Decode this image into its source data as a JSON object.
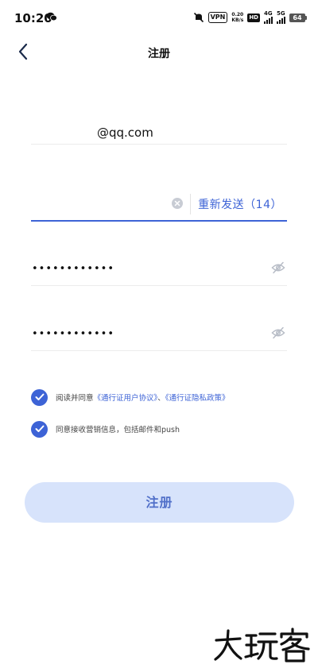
{
  "status_bar": {
    "time": "10:20",
    "vpn": "VPN",
    "speed_value": "0.20",
    "speed_unit": "KB/s",
    "hd": "HD",
    "net1": "4G",
    "net2": "5G",
    "battery": "64"
  },
  "header": {
    "title": "注册"
  },
  "form": {
    "email_value": "@qq.com",
    "resend_label": "重新发送（14）",
    "password_mask": "••••••••••••",
    "confirm_password_mask": "••••••••••••"
  },
  "agreements": {
    "terms_prefix": "阅读并同意",
    "terms_link_user": "《通行证用户协议》",
    "terms_sep": "、",
    "terms_link_privacy": "《通行证隐私政策》",
    "marketing_text": "同意接收营销信息，包括邮件和push",
    "terms_checked": true,
    "marketing_checked": true
  },
  "submit": {
    "label": "注册"
  },
  "colors": {
    "accent": "#3d63d6",
    "button_bg": "#d7e3fb",
    "button_text": "#5170c9"
  },
  "icons": [
    "wechat-icon",
    "mute-icon",
    "back-chevron-icon",
    "clear-icon",
    "eye-off-icon",
    "checkmark-icon"
  ]
}
